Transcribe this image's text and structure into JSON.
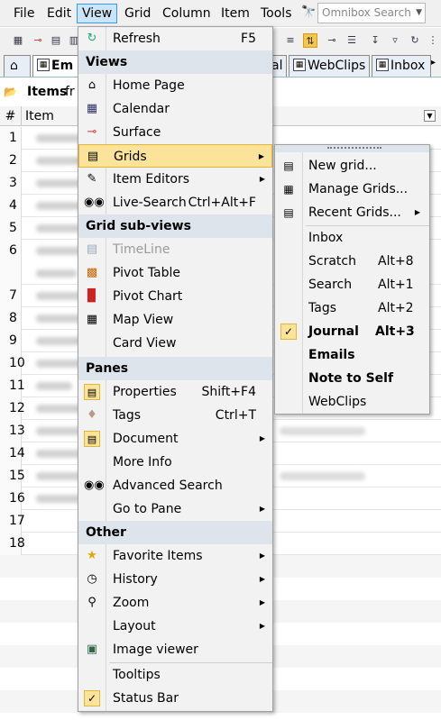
{
  "menubar": {
    "items": [
      "File",
      "Edit",
      "View",
      "Grid",
      "Column",
      "Item",
      "Tools"
    ],
    "omnibox_placeholder": "Omnibox Search"
  },
  "tabs": [
    "Em",
    "al",
    "WebClips",
    "Inbox"
  ],
  "items_header": {
    "label": "Items",
    "sub": "fr"
  },
  "grid": {
    "columns": [
      "#",
      "Item"
    ],
    "rows": [
      "1",
      "2",
      "3",
      "4",
      "5",
      "6",
      "7",
      "8",
      "9",
      "10",
      "11",
      "12",
      "13",
      "14",
      "15",
      "16",
      "17",
      "18"
    ]
  },
  "view_menu": {
    "refresh": {
      "label": "Refresh",
      "shortcut": "F5"
    },
    "views_header": "Views",
    "views": [
      "Home Page",
      "Calendar",
      "Surface",
      "Grids",
      "Item Editors"
    ],
    "live_search": {
      "label": "Live-Search",
      "shortcut": "Ctrl+Alt+F"
    },
    "grid_subviews_header": "Grid sub-views",
    "grid_subviews": [
      "TimeLine",
      "Pivot Table",
      "Pivot Chart",
      "Map View",
      "Card View"
    ],
    "panes_header": "Panes",
    "properties": {
      "label": "Properties",
      "shortcut": "Shift+F4"
    },
    "tags": {
      "label": "Tags",
      "shortcut": "Ctrl+T"
    },
    "panes": [
      "Document",
      "More Info",
      "Advanced Search",
      "Go to Pane"
    ],
    "other_header": "Other",
    "other": [
      "Favorite Items",
      "History",
      "Zoom",
      "Layout",
      "Image viewer",
      "Tooltips",
      "Status Bar"
    ]
  },
  "grids_submenu": {
    "actions": [
      "New grid...",
      "Manage Grids...",
      "Recent Grids..."
    ],
    "grids": [
      {
        "label": "Inbox",
        "shortcut": ""
      },
      {
        "label": "Scratch",
        "shortcut": "Alt+8"
      },
      {
        "label": "Search",
        "shortcut": "Alt+1"
      },
      {
        "label": "Tags",
        "shortcut": "Alt+2"
      },
      {
        "label": "Journal",
        "shortcut": "Alt+3"
      },
      {
        "label": "Emails",
        "shortcut": ""
      },
      {
        "label": "Note to Self",
        "shortcut": ""
      },
      {
        "label": "WebClips",
        "shortcut": ""
      }
    ]
  }
}
